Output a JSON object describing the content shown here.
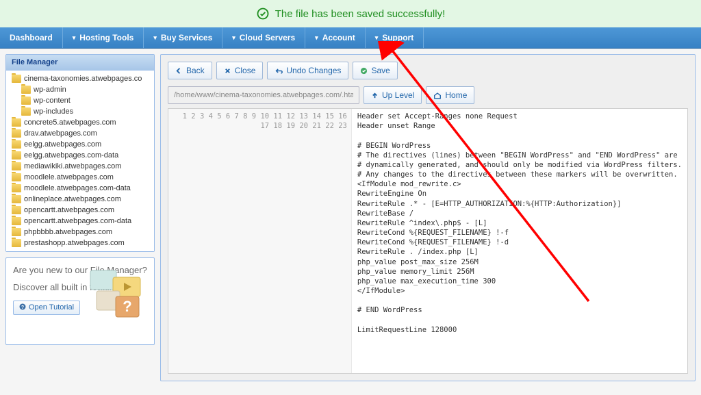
{
  "banner": {
    "message": "The file has been saved successfully!"
  },
  "nav": {
    "items": [
      "Dashboard",
      "Hosting Tools",
      "Buy Services",
      "Cloud Servers",
      "Account",
      "Support"
    ]
  },
  "sidebar": {
    "title": "File Manager",
    "tree": [
      {
        "label": "cinema-taxonomies.atwebpages.co",
        "indent": 0
      },
      {
        "label": "wp-admin",
        "indent": 1
      },
      {
        "label": "wp-content",
        "indent": 1
      },
      {
        "label": "wp-includes",
        "indent": 1
      },
      {
        "label": "concrete5.atwebpages.com",
        "indent": 0
      },
      {
        "label": "drav.atwebpages.com",
        "indent": 0
      },
      {
        "label": "eelgg.atwebpages.com",
        "indent": 0
      },
      {
        "label": "eelgg.atwebpages.com-data",
        "indent": 0
      },
      {
        "label": "mediawikiki.atwebpages.com",
        "indent": 0
      },
      {
        "label": "moodlele.atwebpages.com",
        "indent": 0
      },
      {
        "label": "moodlele.atwebpages.com-data",
        "indent": 0
      },
      {
        "label": "onlineplace.atwebpages.com",
        "indent": 0
      },
      {
        "label": "opencartt.atwebpages.com",
        "indent": 0
      },
      {
        "label": "opencartt.atwebpages.com-data",
        "indent": 0
      },
      {
        "label": "phpbbbb.atwebpages.com",
        "indent": 0
      },
      {
        "label": "prestashopp.atwebpages.com",
        "indent": 0
      }
    ]
  },
  "promo": {
    "line1": "Are you new to our File Manager?",
    "line2": "Discover all built in features.",
    "button": "Open Tutorial"
  },
  "toolbar": {
    "back": "Back",
    "close": "Close",
    "undo": "Undo Changes",
    "save": "Save",
    "uplevel": "Up Level",
    "home": "Home"
  },
  "path": {
    "value": "/home/www/cinema-taxonomies.atwebpages.com/.htacc"
  },
  "editor": {
    "lines": [
      "Header set Accept-Ranges none Request",
      "Header unset Range",
      "",
      "# BEGIN WordPress",
      "# The directives (lines) between \"BEGIN WordPress\" and \"END WordPress\" are",
      "# dynamically generated, and should only be modified via WordPress filters.",
      "# Any changes to the directives between these markers will be overwritten.",
      "<IfModule mod_rewrite.c>",
      "RewriteEngine On",
      "RewriteRule .* - [E=HTTP_AUTHORIZATION:%{HTTP:Authorization}]",
      "RewriteBase /",
      "RewriteRule ^index\\.php$ - [L]",
      "RewriteCond %{REQUEST_FILENAME} !-f",
      "RewriteCond %{REQUEST_FILENAME} !-d",
      "RewriteRule . /index.php [L]",
      "php_value post_max_size 256M",
      "php_value memory_limit 256M",
      "php_value max_execution_time 300",
      "</IfModule>",
      "",
      "# END WordPress",
      "",
      "LimitRequestLine 128000"
    ]
  }
}
